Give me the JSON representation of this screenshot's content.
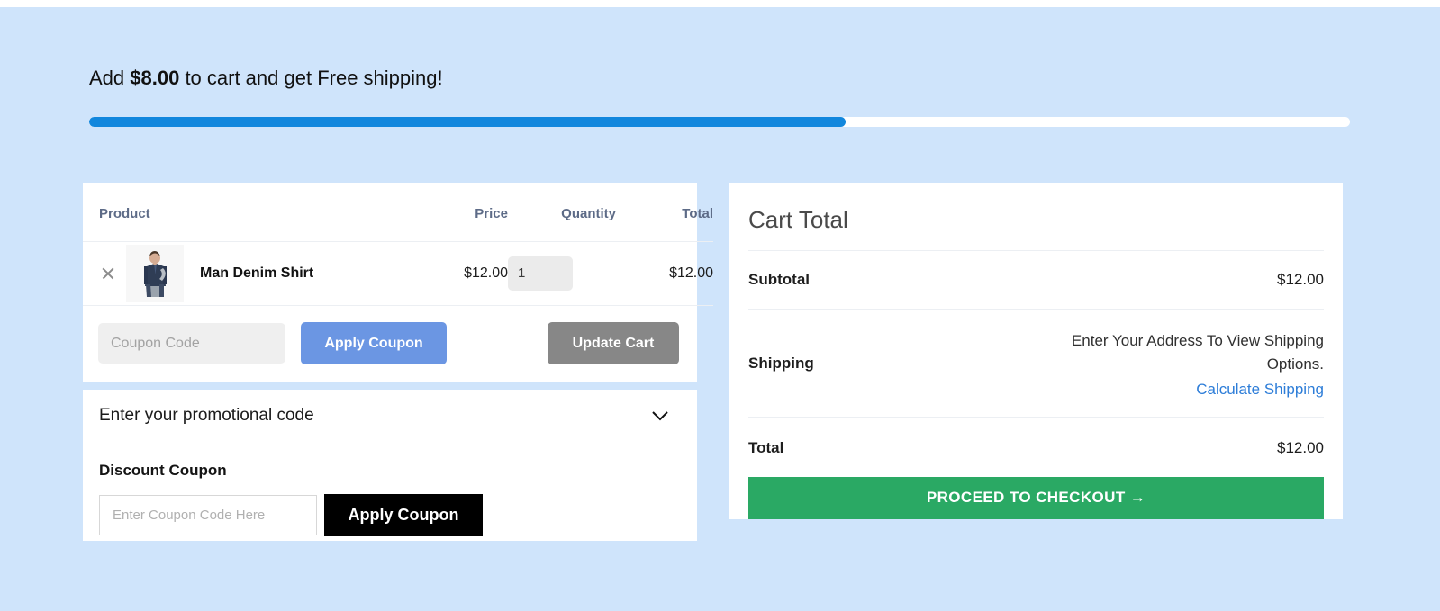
{
  "banner": {
    "prefix": "Add ",
    "amount": "$8.00",
    "suffix": " to cart and get Free shipping!",
    "progress_percent": 60,
    "fill_color": "#1287dd",
    "track_color": "#ffffff"
  },
  "cart": {
    "columns": {
      "product": "Product",
      "price": "Price",
      "quantity": "Quantity",
      "total": "Total"
    },
    "items": [
      {
        "remove_icon": "close-icon",
        "thumbnail_alt": "Man Denim Shirt",
        "name": "Man Denim Shirt",
        "price": "$12.00",
        "quantity": "1",
        "total": "$12.00"
      }
    ],
    "coupon": {
      "placeholder": "Coupon Code",
      "value": "",
      "apply_label": "Apply Coupon",
      "update_label": "Update Cart",
      "apply_color": "#6b96e3",
      "update_color": "#878787"
    }
  },
  "promo": {
    "header": "Enter your promotional code",
    "chevron_icon": "chevron-down-icon",
    "sub_label": "Discount Coupon",
    "input_placeholder": "Enter Coupon Code Here",
    "input_value": "",
    "apply_label": "Apply Coupon",
    "apply_color": "#000000"
  },
  "totals": {
    "title": "Cart Total",
    "subtotal_label": "Subtotal",
    "subtotal_value": "$12.00",
    "shipping_label": "Shipping",
    "shipping_note": "Enter Your Address To View Shipping Options.",
    "shipping_link": "Calculate Shipping",
    "shipping_link_color": "#2d7dd8",
    "total_label": "Total",
    "total_value": "$12.00",
    "checkout_label": "PROCEED TO CHECKOUT →",
    "checkout_color": "#2aa964"
  }
}
